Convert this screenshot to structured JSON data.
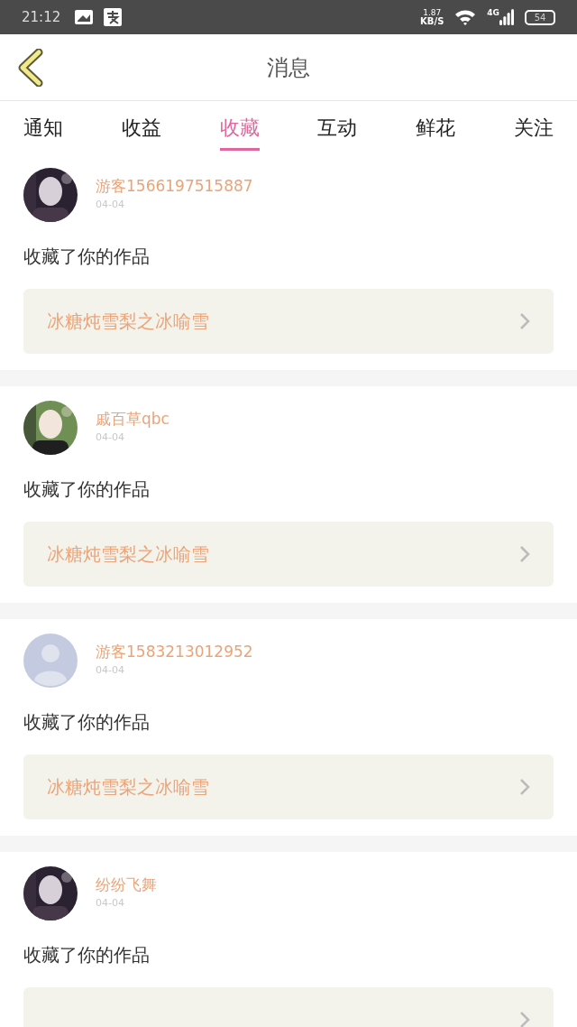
{
  "status_bar": {
    "time": "21:12",
    "speed": "1.87",
    "speed_unit": "KB/S",
    "network": "4G",
    "battery": "54"
  },
  "header": {
    "title": "消息"
  },
  "tabs": [
    {
      "label": "通知",
      "selected": false
    },
    {
      "label": "收益",
      "selected": false
    },
    {
      "label": "收藏",
      "selected": true
    },
    {
      "label": "互动",
      "selected": false
    },
    {
      "label": "鲜花",
      "selected": false
    },
    {
      "label": "关注",
      "selected": false
    }
  ],
  "messages": [
    {
      "name": "游客1566197515887",
      "date": "04-04",
      "text": "收藏了你的作品",
      "work": "冰糖炖雪梨之冰喻雪"
    },
    {
      "name": "戚百草qbc",
      "date": "04-04",
      "text": "收藏了你的作品",
      "work": "冰糖炖雪梨之冰喻雪"
    },
    {
      "avatar": {
        "kind": "default"
      },
      "name": "游客1583213012952",
      "date": "04-04",
      "text": "收藏了你的作品",
      "work": "冰糖炖雪梨之冰喻雪"
    },
    {
      "name": "纷纷飞舞",
      "date": "04-04",
      "text": "收藏了你的作品"
    }
  ]
}
